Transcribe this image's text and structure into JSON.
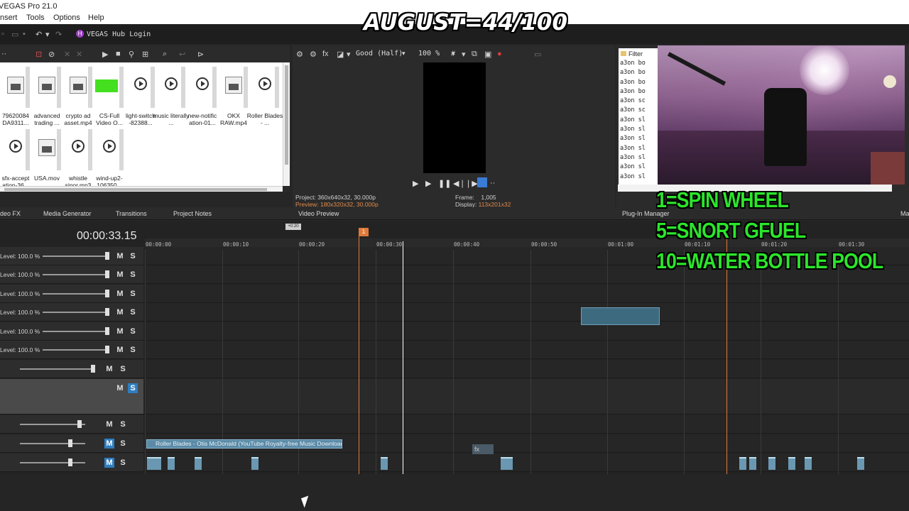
{
  "window": {
    "title": "VEGAS Pro 21.0"
  },
  "menu": [
    "nsert",
    "Tools",
    "Options",
    "Help"
  ],
  "hub": {
    "badge": "H",
    "label": "VEGAS Hub Login"
  },
  "overlay": {
    "title": "AUGUST=44/100",
    "lines": [
      "1=SPIN WHEEL",
      "5=SNORT GFUEL",
      "10=WATER BOTTLE POOL"
    ]
  },
  "media": {
    "items": [
      {
        "label": "79620084 DA9311...",
        "kind": "doc"
      },
      {
        "label": "advanced trading ...",
        "kind": "doc"
      },
      {
        "label": "crypto ad asset.mp4",
        "kind": "doc"
      },
      {
        "label": "CS-Full Video O...",
        "kind": "green"
      },
      {
        "label": "light-switch -82388...",
        "kind": "play"
      },
      {
        "label": "music literally ...",
        "kind": "play"
      },
      {
        "label": "new-notific ation-01...",
        "kind": "play"
      },
      {
        "label": "OKX RAW.mp4",
        "kind": "doc"
      },
      {
        "label": "Roller Blades - ...",
        "kind": "play"
      },
      {
        "label": "sfx-accept ation-36...",
        "kind": "play"
      },
      {
        "label": "USA.mov",
        "kind": "doc"
      },
      {
        "label": "whistle sinor.mp3",
        "kind": "play"
      },
      {
        "label": "wind-up2- 106350...",
        "kind": "play"
      }
    ]
  },
  "preview": {
    "quality": "Good (Half)",
    "zoom": "100 %",
    "project_label": "Project:",
    "project_value": "360x640x32, 30.000p",
    "preview_label": "Preview:",
    "preview_value": "180x320x32, 30.000p",
    "frame_label": "Frame:",
    "frame_value": "1,005",
    "display_label": "Display:",
    "display_value": "113x201x32"
  },
  "explorer": {
    "filter": "Filter",
    "items": [
      "a3on bo",
      "a3on bo",
      "a3on bo",
      "a3on bo",
      "a3on sc",
      "a3on sc",
      "a3on sl",
      "a3on sl",
      "a3on sl",
      "a3on sl",
      "a3on sl",
      "a3on sl",
      "a3on sl"
    ]
  },
  "tabs": [
    "deo FX",
    "Media Generator",
    "Transitions",
    "Project Notes",
    "Video Preview",
    "Plug-In Manager",
    "Ma"
  ],
  "timeline": {
    "timecode": "00:00:33.15",
    "loop_label": "+0:20",
    "cursor_flag": "1",
    "ticks": [
      "00:00:00",
      "00:00:10",
      "00:00:20",
      "00:00:30",
      "00:00:40",
      "00:00:50",
      "00:01:00",
      "00:01:10",
      "00:01:20",
      "00:01:30"
    ],
    "tracks": [
      {
        "level": "Level: 100.0 %",
        "m": "M",
        "s": "S"
      },
      {
        "level": "Level: 100.0 %",
        "m": "M",
        "s": "S"
      },
      {
        "level": "Level: 100.0 %",
        "m": "M",
        "s": "S"
      },
      {
        "level": "Level: 100.0 %",
        "m": "M",
        "s": "S"
      },
      {
        "level": "Level: 100.0 %",
        "m": "M",
        "s": "S"
      },
      {
        "level": "Level: 100.0 %",
        "m": "M",
        "s": "S"
      },
      {
        "level": "",
        "m": "M",
        "s": "S"
      },
      {
        "level": "",
        "m": "M",
        "s": "S"
      },
      {
        "level": "",
        "m": "M",
        "s": "S"
      },
      {
        "level": "",
        "m": "M",
        "s": "S"
      },
      {
        "level": "",
        "m": "M",
        "s": "S"
      }
    ],
    "audio_clip": "Roller Blades - Otis McDonald (YouTube Royalty-free Music Download)",
    "fx_label": "fx"
  }
}
